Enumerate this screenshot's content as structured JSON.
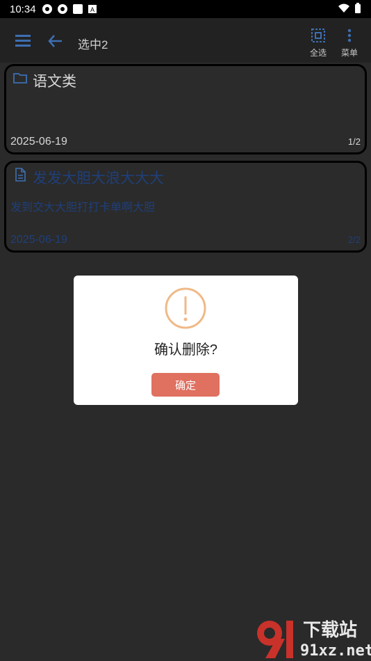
{
  "status": {
    "time": "10:34"
  },
  "appbar": {
    "title": "选中2",
    "select_all_label": "全选",
    "menu_label": "菜单"
  },
  "cards": [
    {
      "title": "语文类",
      "subtitle": "",
      "date": "2025-06-19",
      "page": "1/2",
      "icon": "folder-icon"
    },
    {
      "title": "发发大胆大浪大大大",
      "subtitle": "发到交大大胆打打卡单啊大胆",
      "date": "2025-06-19",
      "page": "2/2",
      "icon": "document-icon"
    }
  ],
  "dialog": {
    "message": "确认删除?",
    "ok_label": "确定",
    "accent": "#e07060",
    "warn_color": "#f0b987"
  },
  "watermark": {
    "brand_top": "下载站",
    "brand_bottom": "91xz.net"
  }
}
